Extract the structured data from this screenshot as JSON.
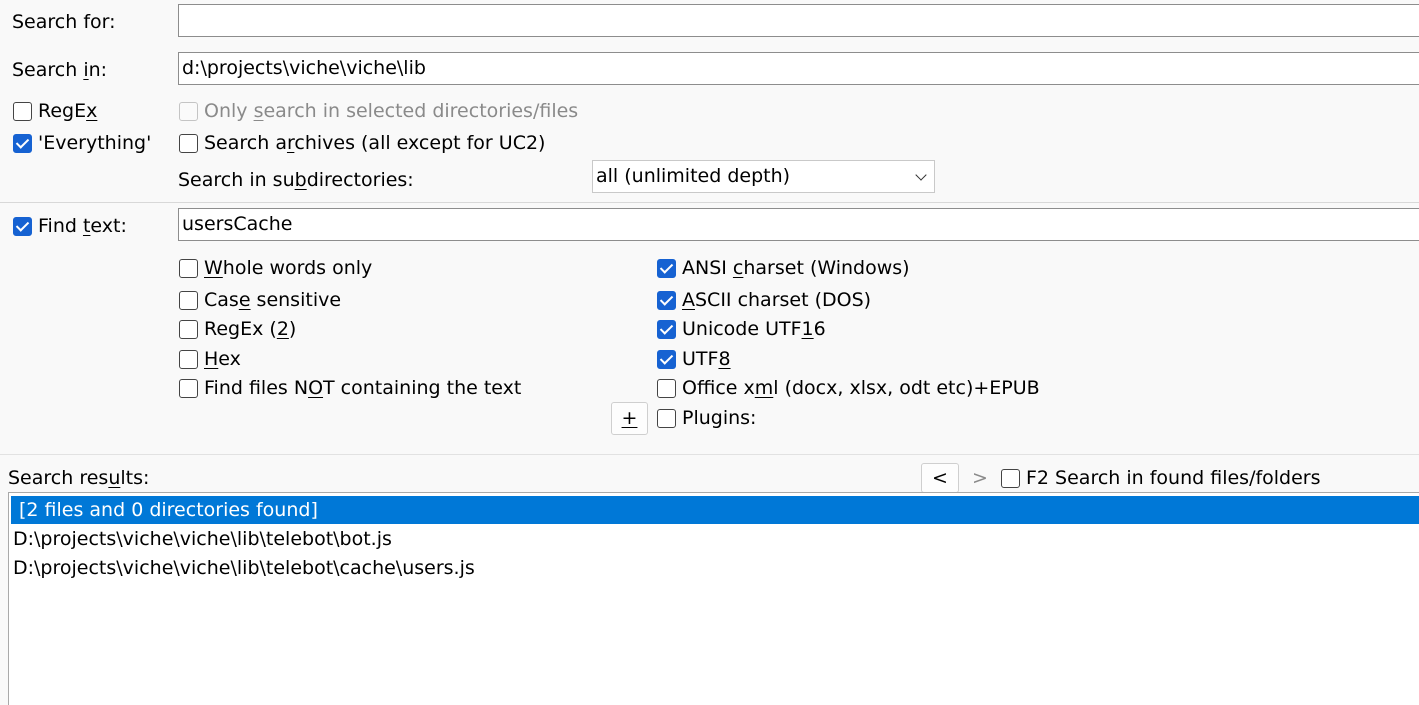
{
  "search_for": {
    "label": "Search for:",
    "value": ""
  },
  "search_in": {
    "label_pre": "Search ",
    "label_u": "i",
    "label_post": "n:",
    "value": "d:\\projects\\viche\\viche\\lib"
  },
  "regex": {
    "label_pre": "RegE",
    "label_u": "x",
    "label_post": "",
    "checked": false
  },
  "only_selected": {
    "label_pre": "Only ",
    "label_u": "s",
    "label_post": "earch in selected directories/files",
    "disabled": true
  },
  "everything": {
    "label": "'Everything'",
    "checked": true
  },
  "search_archives": {
    "label_pre": "Search a",
    "label_u": "r",
    "label_post": "chives (all except for UC2)",
    "checked": false
  },
  "subdirs": {
    "label_pre": "Search in su",
    "label_u": "b",
    "label_post": "directories:",
    "selected": "all (unlimited depth)"
  },
  "find_text": {
    "label_pre": "Find ",
    "label_u": "t",
    "label_post": "ext:",
    "checked": true,
    "value": "usersCache"
  },
  "options_left": [
    {
      "name": "whole-words-checkbox",
      "pre": "",
      "u": "W",
      "post": "hole words only",
      "checked": false
    },
    {
      "name": "case-sensitive-checkbox",
      "pre": "Cas",
      "u": "e",
      "post": " sensitive",
      "checked": false
    },
    {
      "name": "regex2-checkbox",
      "pre": "RegEx (",
      "u": "2",
      "post": ")",
      "checked": false
    },
    {
      "name": "hex-checkbox",
      "pre": "",
      "u": "H",
      "post": "ex",
      "checked": false
    },
    {
      "name": "not-containing-checkbox",
      "pre": "Find files N",
      "u": "O",
      "post": "T containing the text",
      "checked": false
    }
  ],
  "options_right": [
    {
      "name": "ansi-checkbox",
      "pre": "ANSI ",
      "u": "c",
      "post": "harset (Windows)",
      "checked": true
    },
    {
      "name": "ascii-checkbox",
      "pre": "",
      "u": "A",
      "post": "SCII charset (DOS)",
      "checked": true
    },
    {
      "name": "utf16-checkbox",
      "pre": "Unicode UTF",
      "u": "1",
      "post": "6",
      "checked": true
    },
    {
      "name": "utf8-checkbox",
      "pre": "UTF",
      "u": "8",
      "post": "",
      "checked": true
    },
    {
      "name": "office-xml-checkbox",
      "pre": "Office x",
      "u": "m",
      "post": "l (docx, xlsx, odt etc)+EPUB",
      "checked": false
    }
  ],
  "plugins": {
    "button": "+",
    "label": "Plugins:",
    "checked": false
  },
  "results": {
    "label_pre": "Search res",
    "label_u": "u",
    "label_post": "lts:",
    "prev": "<",
    "next": ">",
    "f2_label": "F2 Search in found files/folders",
    "f2_checked": false,
    "rows": [
      "[2 files and 0 directories found]",
      "D:\\projects\\viche\\viche\\lib\\telebot\\bot.js",
      "D:\\projects\\viche\\viche\\lib\\telebot\\cache\\users.js"
    ]
  }
}
